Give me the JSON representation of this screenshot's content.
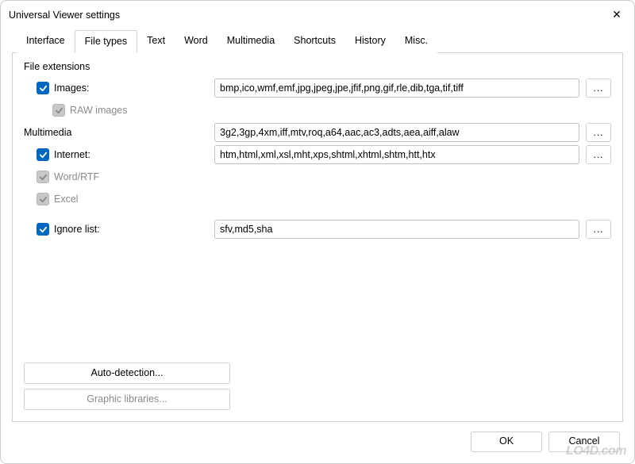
{
  "window": {
    "title": "Universal Viewer settings",
    "close_label": "✕"
  },
  "tabs": {
    "interface": "Interface",
    "file_types": "File types",
    "text": "Text",
    "word": "Word",
    "multimedia": "Multimedia",
    "shortcuts": "Shortcuts",
    "history": "History",
    "misc": "Misc."
  },
  "section": {
    "file_extensions": "File extensions",
    "multimedia": "Multimedia"
  },
  "checks": {
    "images": "Images:",
    "raw_images": "RAW images",
    "internet": "Internet:",
    "word_rtf": "Word/RTF",
    "excel": "Excel",
    "ignore_list": "Ignore list:"
  },
  "fields": {
    "images": "bmp,ico,wmf,emf,jpg,jpeg,jpe,jfif,png,gif,rle,dib,tga,tif,tiff",
    "multimedia": "3g2,3gp,4xm,iff,mtv,roq,a64,aac,ac3,adts,aea,aiff,alaw",
    "internet": "htm,html,xml,xsl,mht,xps,shtml,xhtml,shtm,htt,htx",
    "ignore_list": "sfv,md5,sha"
  },
  "buttons": {
    "ellipsis": "...",
    "auto_detection": "Auto-detection...",
    "graphic_libraries": "Graphic libraries...",
    "ok": "OK",
    "cancel": "Cancel"
  },
  "watermark": "LO4D.com"
}
